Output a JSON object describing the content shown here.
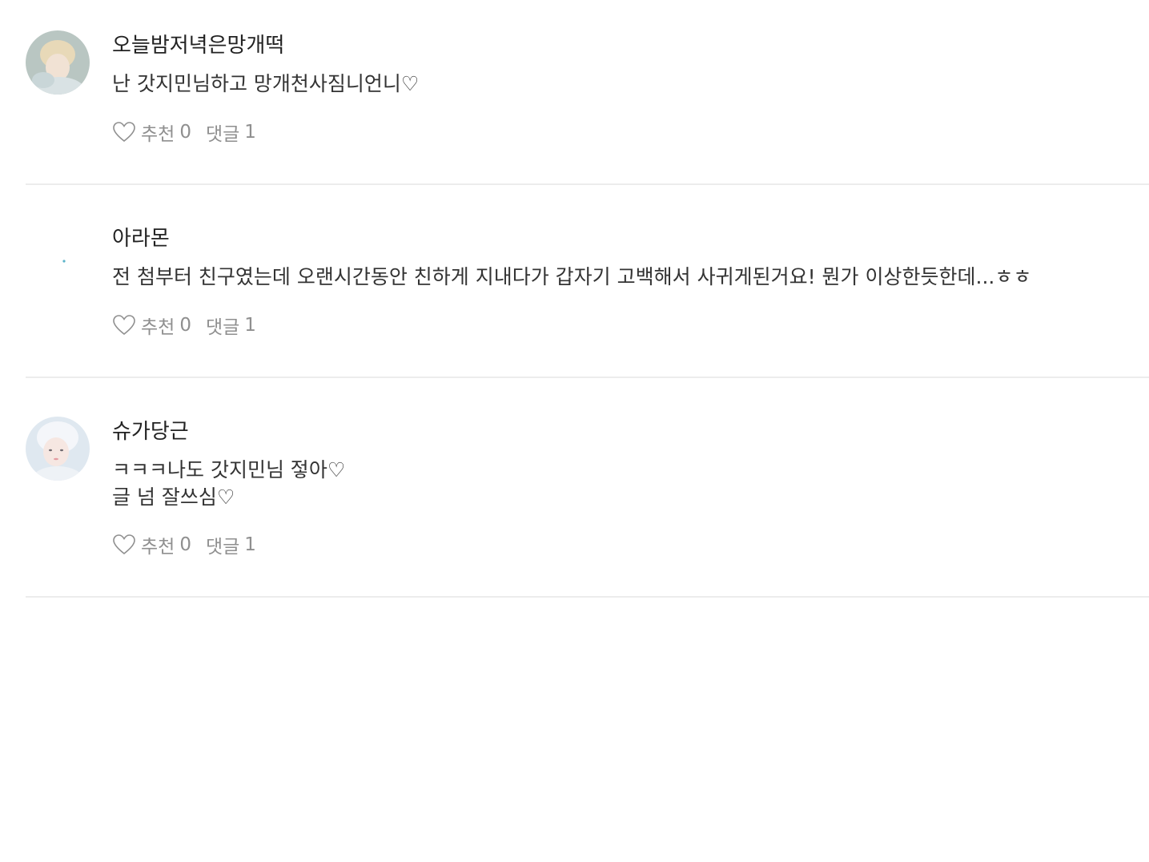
{
  "comments": [
    {
      "author": "오늘밤저녁은망개떡",
      "text": "난 갓지민님하고 망개천사짐니언니♡",
      "like_label": "추천",
      "like_count": "0",
      "reply_label": "댓글",
      "reply_count": "1"
    },
    {
      "author": "아라몬",
      "text": "전 첨부터 친구였는데 오랜시간동안 친하게 지내다가 갑자기 고백해서 사귀게된거요! 뭔가 이상한듯한데...ㅎㅎ",
      "like_label": "추천",
      "like_count": "0",
      "reply_label": "댓글",
      "reply_count": "1"
    },
    {
      "author": "슈가당근",
      "text": "ㅋㅋㅋ나도 갓지민님 젛아♡\n글 넘 잘쓰심♡",
      "like_label": "추천",
      "like_count": "0",
      "reply_label": "댓글",
      "reply_count": "1"
    }
  ],
  "icons": {
    "like": "heart-outline-icon"
  },
  "colors": {
    "text": "#333333",
    "meta": "#8f8f8f",
    "divider": "#ececec"
  }
}
